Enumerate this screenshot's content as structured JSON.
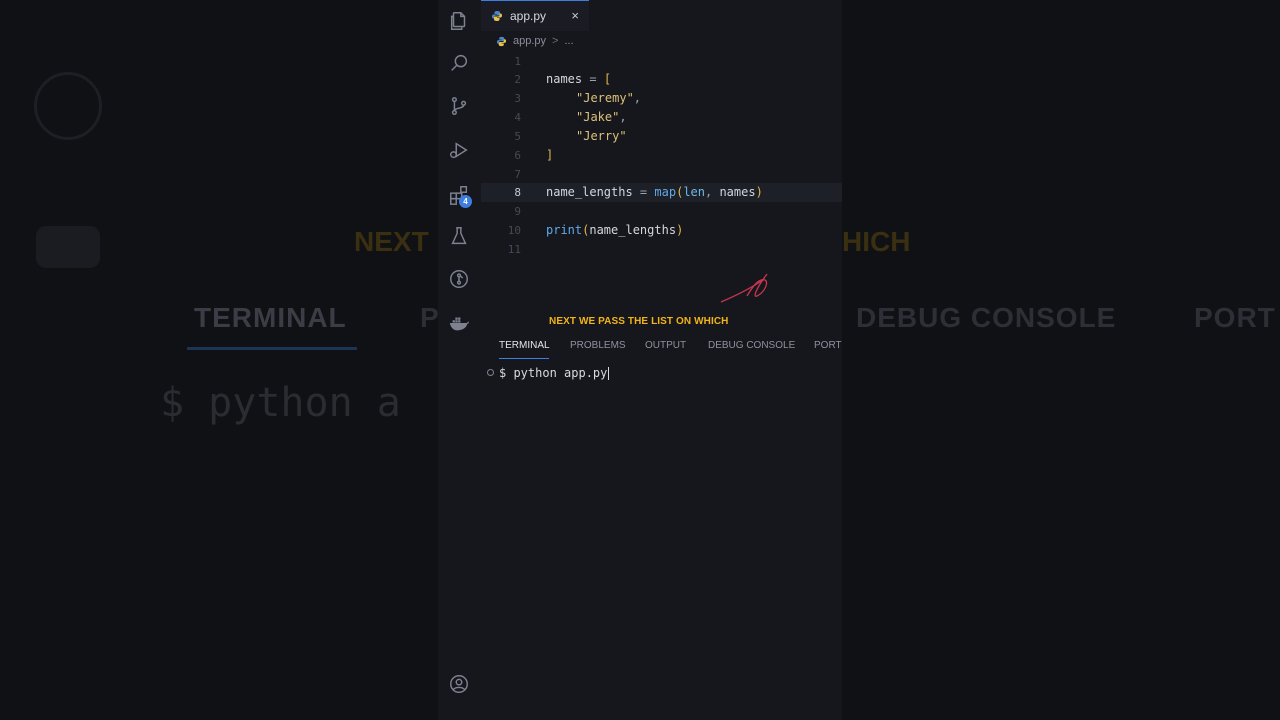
{
  "background": {
    "caption_left": "NEXT",
    "caption_right": "HICH",
    "tab_left": "TERMINAL",
    "tab_left_partial": "P",
    "tab_right": "DEBUG CONSOLE",
    "tab_right_partial": "PORT",
    "terminal_text": "$ python a"
  },
  "tab": {
    "label": "app.py",
    "close": "×"
  },
  "breadcrumb": {
    "file": "app.py",
    "separator": ">",
    "more": "..."
  },
  "activity_bar": {
    "items": [
      "explorer-icon",
      "search-icon",
      "source-control-icon",
      "run-debug-icon",
      "extensions-icon",
      "testing-icon",
      "git-graph-icon",
      "docker-icon"
    ],
    "extensions_badge": "4",
    "bottom": "account-icon"
  },
  "editor": {
    "current_line": 8,
    "lines": [
      {
        "n": "1"
      },
      {
        "n": "2"
      },
      {
        "n": "3"
      },
      {
        "n": "4"
      },
      {
        "n": "5"
      },
      {
        "n": "6"
      },
      {
        "n": "7"
      },
      {
        "n": "8"
      },
      {
        "n": "9"
      },
      {
        "n": "10"
      },
      {
        "n": "11"
      }
    ],
    "code": {
      "l2_var": "names",
      "l2_op": " = ",
      "l2_br": "[",
      "l3": "\"Jeremy\"",
      "l3_comma": ",",
      "l4": "\"Jake\"",
      "l4_comma": ",",
      "l5": "\"Jerry\"",
      "l6": "]",
      "l8_var": "name_lengths",
      "l8_op": " = ",
      "l8_fn": "map",
      "l8_open": "(",
      "l8_arg1": "len",
      "l8_sep": ", ",
      "l8_arg2": "names",
      "l8_close": ")",
      "l10_fn": "print",
      "l10_open": "(",
      "l10_arg": "name_lengths",
      "l10_close": ")"
    }
  },
  "caption": "NEXT WE PASS THE LIST ON WHICH",
  "panel": {
    "tabs": [
      "TERMINAL",
      "PROBLEMS",
      "OUTPUT",
      "DEBUG CONSOLE",
      "PORT"
    ],
    "active": "TERMINAL"
  },
  "terminal": {
    "command": "$ python app.py"
  },
  "colors": {
    "accent": "#3f7ee0",
    "caption": "#f2b418",
    "annotation": "#d23a55"
  }
}
